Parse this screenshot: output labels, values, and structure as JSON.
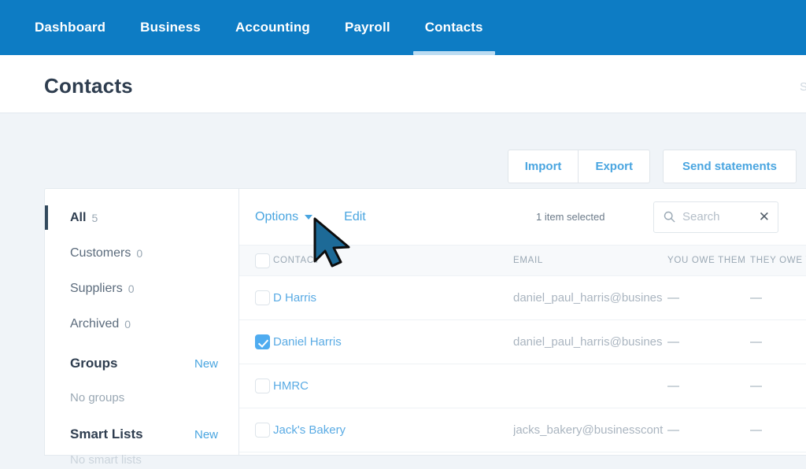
{
  "nav": {
    "items": [
      {
        "label": "Dashboard",
        "active": false
      },
      {
        "label": "Business",
        "active": false
      },
      {
        "label": "Accounting",
        "active": false
      },
      {
        "label": "Payroll",
        "active": false
      },
      {
        "label": "Contacts",
        "active": true
      }
    ],
    "bar_color": "#0d7cc4",
    "active_underline_color": "#bcdcf2"
  },
  "header": {
    "title": "Contacts",
    "right_clipped_text": "S"
  },
  "actions": {
    "import_label": "Import",
    "export_label": "Export",
    "send_statements_label": "Send statements",
    "link_color": "#49a5e0"
  },
  "sidebar": {
    "items": [
      {
        "label": "All",
        "count": "5",
        "active": true
      },
      {
        "label": "Customers",
        "count": "0",
        "active": false
      },
      {
        "label": "Suppliers",
        "count": "0",
        "active": false
      },
      {
        "label": "Archived",
        "count": "0",
        "active": false
      }
    ],
    "groups": {
      "label": "Groups",
      "new_label": "New",
      "empty_text": "No groups"
    },
    "smart_lists": {
      "label": "Smart Lists",
      "new_label": "New",
      "clipped_text": "No smart lists"
    }
  },
  "toolbar": {
    "options_label": "Options",
    "edit_label": "Edit",
    "selected_text": "1 item selected",
    "search_placeholder": "Search",
    "search_value": "",
    "clear_glyph": "✕"
  },
  "table": {
    "columns": [
      {
        "key": "contact",
        "label": "CONTACT"
      },
      {
        "key": "email",
        "label": "EMAIL"
      },
      {
        "key": "you_owe_them",
        "label": "YOU OWE THEM"
      },
      {
        "key": "they_owe_you",
        "label": "THEY OWE YOU"
      }
    ],
    "rows": [
      {
        "selected": false,
        "contact": "D Harris",
        "email": "daniel_paul_harris@busines",
        "you_owe_them": "—",
        "they_owe_you": "—"
      },
      {
        "selected": true,
        "contact": "Daniel Harris",
        "email": "daniel_paul_harris@busines",
        "you_owe_them": "—",
        "they_owe_you": "—"
      },
      {
        "selected": false,
        "contact": "HMRC",
        "email": "",
        "you_owe_them": "—",
        "they_owe_you": "—"
      },
      {
        "selected": false,
        "contact": "Jack's Bakery",
        "email": "jacks_bakery@businesscont",
        "you_owe_them": "—",
        "they_owe_you": "—"
      }
    ]
  },
  "cursor": {
    "color": "#1d6a97",
    "outline": "#0d0d0d"
  }
}
